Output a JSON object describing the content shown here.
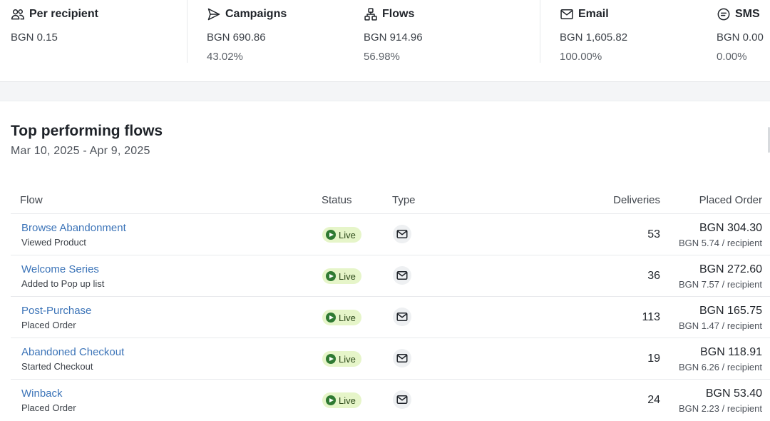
{
  "summary": {
    "per_recipient": {
      "label": "Per recipient",
      "value": "BGN 0.15",
      "icon": "users-icon"
    },
    "campaigns": {
      "label": "Campaigns",
      "value": "BGN 690.86",
      "percent": "43.02%",
      "icon": "send-icon"
    },
    "flows": {
      "label": "Flows",
      "value": "BGN 914.96",
      "percent": "56.98%",
      "icon": "flow-hierarchy-icon"
    },
    "email": {
      "label": "Email",
      "value": "BGN 1,605.82",
      "percent": "100.00%",
      "icon": "envelope-icon"
    },
    "sms": {
      "label": "SMS",
      "value": "BGN 0.00",
      "percent": "0.00%",
      "icon": "chat-bubble-icon"
    }
  },
  "flows_card": {
    "title": "Top performing flows",
    "date_range": "Mar 10, 2025 - Apr 9, 2025",
    "columns": {
      "flow": "Flow",
      "status": "Status",
      "type": "Type",
      "deliveries": "Deliveries",
      "placed_order": "Placed Order"
    },
    "rows": [
      {
        "name": "Browse Abandonment",
        "trigger": "Viewed Product",
        "status": "Live",
        "type_icon": "envelope-icon",
        "deliveries": "53",
        "placed_order": "BGN 304.30",
        "per_recipient": "BGN 5.74 / recipient"
      },
      {
        "name": "Welcome Series",
        "trigger": "Added to Pop up list",
        "status": "Live",
        "type_icon": "envelope-icon",
        "deliveries": "36",
        "placed_order": "BGN 272.60",
        "per_recipient": "BGN 7.57 / recipient"
      },
      {
        "name": "Post-Purchase",
        "trigger": "Placed Order",
        "status": "Live",
        "type_icon": "envelope-icon",
        "deliveries": "113",
        "placed_order": "BGN 165.75",
        "per_recipient": "BGN 1.47 / recipient"
      },
      {
        "name": "Abandoned Checkout",
        "trigger": "Started Checkout",
        "status": "Live",
        "type_icon": "envelope-icon",
        "deliveries": "19",
        "placed_order": "BGN 118.91",
        "per_recipient": "BGN 6.26 / recipient"
      },
      {
        "name": "Winback",
        "trigger": "Placed Order",
        "status": "Live",
        "type_icon": "envelope-icon",
        "deliveries": "24",
        "placed_order": "BGN 53.40",
        "per_recipient": "BGN 2.23 / recipient"
      }
    ]
  },
  "colors": {
    "link": "#3c74b8",
    "live_badge_bg": "#e6f5c9",
    "live_dot": "#2f7a32"
  }
}
